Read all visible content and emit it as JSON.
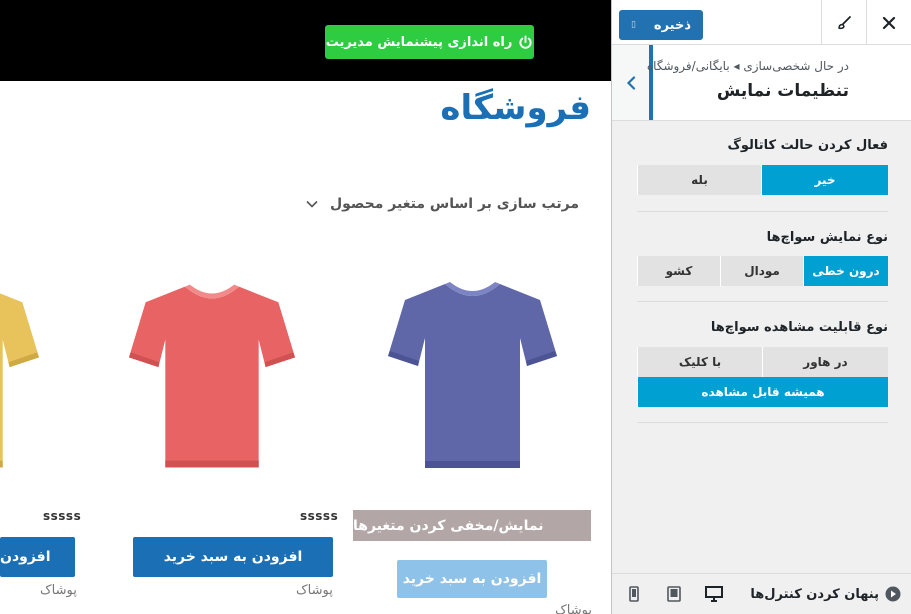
{
  "preview": {
    "admin_button": "راه اندازی پیشنمایش مدیریت",
    "shop_title": "فروشگاه",
    "sort_label": "مرتب سازی بر اساس متغیر محصول",
    "products": [
      {
        "color_name": "blue",
        "color": "#5f67a8",
        "button": "افزودن به سبد خرید",
        "category": "پوشاک",
        "variations_toggle": "نمایش/مخفی کردن متغیرها"
      },
      {
        "color_name": "red",
        "color": "#e86464",
        "rating": "sssss",
        "button": "افزودن به سبد خرید",
        "category": "پوشاک"
      },
      {
        "color_name": "yellow",
        "color": "#e8c25a",
        "rating": "sssss",
        "button": "افزودن",
        "category": "پوشاک"
      }
    ]
  },
  "sidebar": {
    "save_label": "ذخیره",
    "breadcrumb": "در حال شخصی‌سازی ◂ بایگانی/فروشگاه",
    "panel_title": "تنظیمات نمایش",
    "controls": [
      {
        "label": "فعال کردن حالت کاتالوگ",
        "options": [
          "خیر",
          "بله"
        ],
        "selected": "خیر"
      },
      {
        "label": "نوع نمایش سواچ‌ها",
        "options": [
          "درون خطی",
          "مودال",
          "کشو"
        ],
        "selected": "درون خطی"
      },
      {
        "label": "نوع قابلیت مشاهده سواچ‌ها",
        "options": [
          "در هاور",
          "با کلیک",
          "همیشه قابل مشاهده"
        ],
        "selected": "همیشه قابل مشاهده"
      }
    ],
    "footer": {
      "hide_controls": "پنهان کردن کنترل‌ها"
    }
  },
  "colors": {
    "accent": "#2271b1",
    "segment_active": "#00a0d2",
    "admin_green": "#2ecc40",
    "shop_title": "#1a6fb5",
    "add_button": "#1a6fb5",
    "add_button_disabled": "#8fc2e8"
  }
}
